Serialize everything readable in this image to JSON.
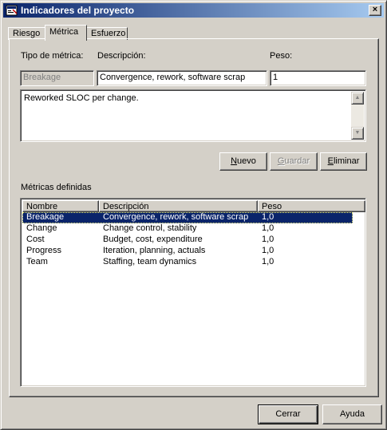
{
  "window": {
    "title": "Indicadores del proyecto",
    "close_glyph": "×",
    "icon": "app-icon"
  },
  "tabs": [
    {
      "label": "Riesgo",
      "active": false
    },
    {
      "label": "Métrica",
      "active": true
    },
    {
      "label": "Esfuerzo",
      "active": false
    }
  ],
  "form": {
    "tipo_label": "Tipo de métrica:",
    "descripcion_label": "Descripción:",
    "peso_label": "Peso:",
    "tipo_value": "Breakage",
    "descripcion_value": "Convergence, rework, software scrap",
    "peso_value": "1",
    "notes": "Reworked SLOC per change."
  },
  "actions": {
    "nuevo": {
      "prefix": "",
      "accel": "N",
      "rest": "uevo"
    },
    "guardar": {
      "prefix": "",
      "accel": "G",
      "rest": "uardar"
    },
    "eliminar": {
      "prefix": "",
      "accel": "E",
      "rest": "liminar"
    }
  },
  "list": {
    "label": "Métricas definidas",
    "columns": [
      "Nombre",
      "Descripción",
      "Peso"
    ],
    "rows": [
      {
        "nombre": "Breakage",
        "descripcion": "Convergence, rework, software scrap",
        "peso": "1,0",
        "selected": true
      },
      {
        "nombre": "Change",
        "descripcion": "Change control, stability",
        "peso": "1,0",
        "selected": false
      },
      {
        "nombre": "Cost",
        "descripcion": "Budget, cost, expenditure",
        "peso": "1,0",
        "selected": false
      },
      {
        "nombre": "Progress",
        "descripcion": "Iteration, planning, actuals",
        "peso": "1,0",
        "selected": false
      },
      {
        "nombre": "Team",
        "descripcion": "Staffing, team dynamics",
        "peso": "1,0",
        "selected": false
      }
    ]
  },
  "footer": {
    "cerrar": "Cerrar",
    "ayuda": "Ayuda"
  },
  "colors": {
    "titlebar_start": "#0a246a",
    "titlebar_end": "#a6caf0",
    "face": "#d4d0c8",
    "selection": "#0a246a"
  }
}
